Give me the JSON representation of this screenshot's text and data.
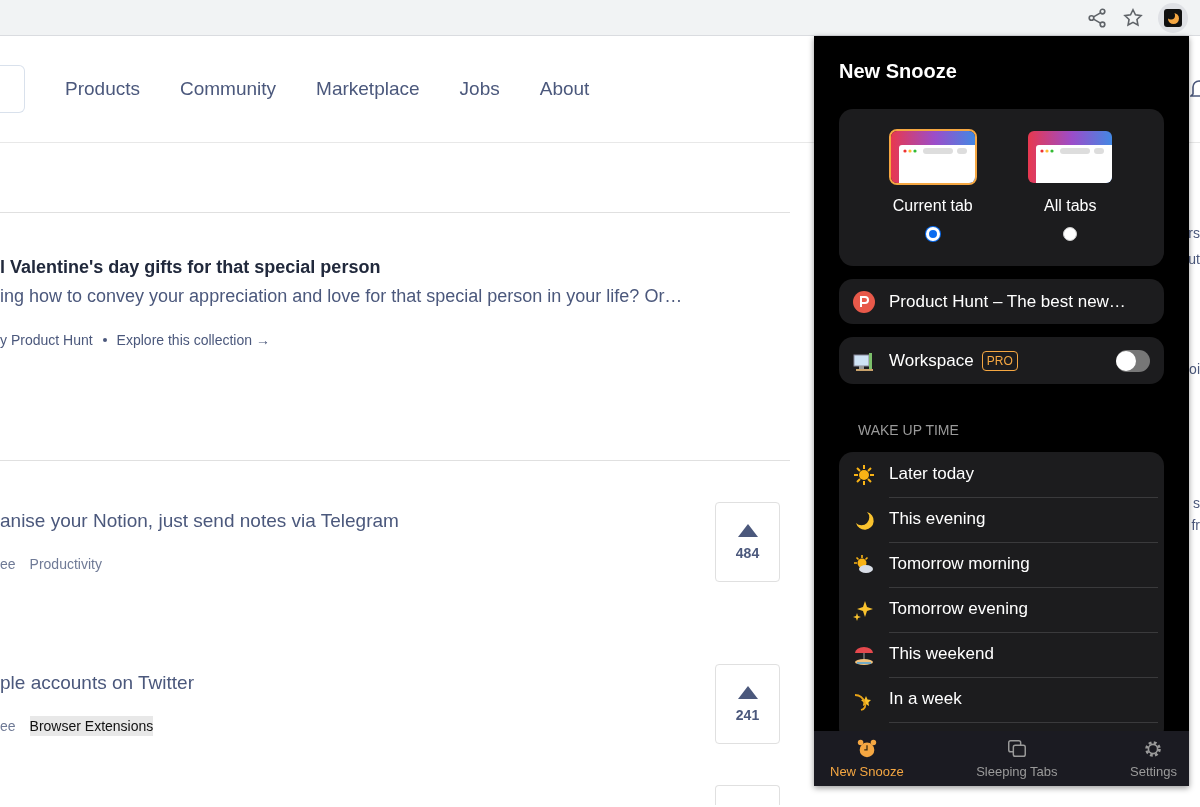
{
  "browser_toolbar": {
    "extension_active": true
  },
  "nav": {
    "items": [
      "Products",
      "Community",
      "Marketplace",
      "Jobs",
      "About"
    ]
  },
  "posts": [
    {
      "kind": "collection",
      "title": "l Valentine's day gifts for that special person",
      "description": "ing how to convey your appreciation and love for that special person in your life? Or…",
      "meta": [
        "y Product Hunt",
        "Explore this collection →"
      ]
    },
    {
      "kind": "product",
      "tagline": "anise your Notion, just send notes via Telegram",
      "tags": [
        {
          "label": "ee",
          "highlighted": false
        },
        {
          "label": "Productivity",
          "highlighted": false
        }
      ],
      "votes": "484"
    },
    {
      "kind": "product",
      "tagline": "ple accounts on Twitter",
      "tags": [
        {
          "label": "ee",
          "highlighted": false
        },
        {
          "label": "Browser Extensions",
          "highlighted": true
        }
      ],
      "votes": "241"
    }
  ],
  "side_fragments": [
    "rs",
    "ut",
    "oi",
    "s",
    "fr"
  ],
  "popup": {
    "title": "New Snooze",
    "scope_options": [
      {
        "label": "Current tab",
        "selected": true
      },
      {
        "label": "All tabs",
        "selected": false
      }
    ],
    "current_page": {
      "title": "Product Hunt – The best new…"
    },
    "workspace": {
      "label": "Workspace",
      "badge": "PRO",
      "on": false
    },
    "section_label": "WAKE UP TIME",
    "wake_options": [
      {
        "label": "Later today",
        "kind": "sun"
      },
      {
        "label": "This evening",
        "kind": "moon"
      },
      {
        "label": "Tomorrow morning",
        "kind": "sun-cloud"
      },
      {
        "label": "Tomorrow evening",
        "kind": "sparkles"
      },
      {
        "label": "This weekend",
        "kind": "beach"
      },
      {
        "label": "In a week",
        "kind": "shooting-star"
      }
    ],
    "bottom_tabs": [
      {
        "label": "New Snooze",
        "kind": "alarm",
        "selected": true
      },
      {
        "label": "Sleeping Tabs",
        "kind": "tabs",
        "selected": false
      },
      {
        "label": "Settings",
        "kind": "gear",
        "selected": false
      }
    ]
  }
}
